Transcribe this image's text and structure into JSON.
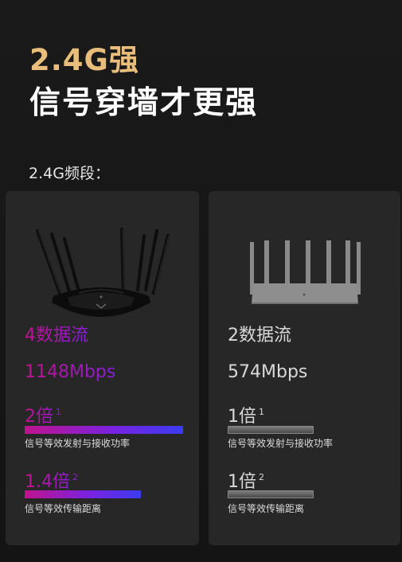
{
  "header": {
    "title_accent": "2.4G强",
    "title_main": "信号穿墙才更强",
    "band_label": "2.4G频段："
  },
  "left_card": {
    "streams": "4数据流",
    "speed": "1148Mbps",
    "power_multiplier": "2倍",
    "power_sup": "1",
    "power_note": "信号等效发射与接收功率",
    "power_level": 1.0,
    "distance_multiplier": "1.4倍",
    "distance_sup": "2",
    "distance_note": "信号等效传输距离",
    "distance_level": 0.7
  },
  "right_card": {
    "streams": "2数据流",
    "speed": "574Mbps",
    "power_multiplier": "1倍",
    "power_sup": "1",
    "power_note": "信号等效发射与接收功率",
    "power_level": 0.5,
    "distance_multiplier": "1倍",
    "distance_sup": "2",
    "distance_note": "信号等效传输距离",
    "distance_level": 0.5
  },
  "colors": {
    "accent_gold": "#e9bd7b",
    "gradient_start": "#c0148e",
    "gradient_end": "#3b3cf0",
    "card_bg": "#272727"
  }
}
